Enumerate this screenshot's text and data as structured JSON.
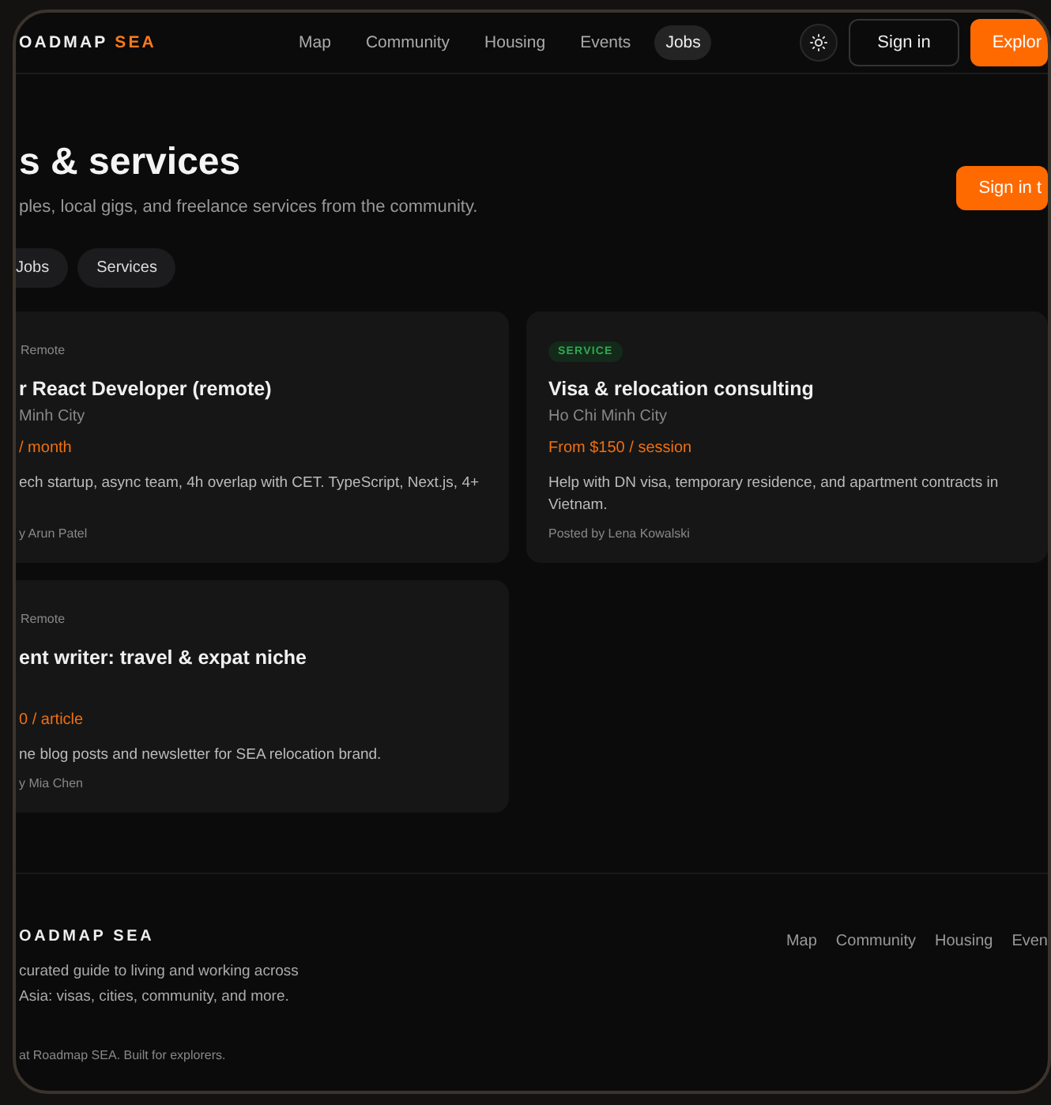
{
  "header": {
    "logo": {
      "name": "OADMAP",
      "accent": "SEA"
    },
    "nav": [
      {
        "label": "Map",
        "selected": false
      },
      {
        "label": "Community",
        "selected": false
      },
      {
        "label": "Housing",
        "selected": false
      },
      {
        "label": "Events",
        "selected": false
      },
      {
        "label": "Jobs",
        "selected": true
      }
    ],
    "sign_in": "Sign in",
    "explore": "Explor"
  },
  "page": {
    "title": "s & services",
    "subtitle": "ples, local gigs, and freelance services from the community.",
    "action": "Sign in t",
    "filters": [
      {
        "label": "Jobs",
        "selected": false
      },
      {
        "label": "Services",
        "selected": false
      }
    ]
  },
  "listings": [
    {
      "kind": "job",
      "tag": "Remote",
      "title": "r React Developer (remote)",
      "location": "Minh City",
      "price": "/ month",
      "description": "ech startup, async team, 4h overlap with CET. TypeScript, Next.js, 4+",
      "author": "y Arun Patel"
    },
    {
      "kind": "service",
      "tag": "SERVICE",
      "title": "Visa & relocation consulting",
      "location": "Ho Chi Minh City",
      "price": "From $150 / session",
      "description": "Help with DN visa, temporary residence, and apartment contracts in Vietnam.",
      "author": "Posted by Lena Kowalski"
    },
    {
      "kind": "job",
      "tag": "Remote",
      "title": "ent writer: travel & expat niche",
      "price": "0 / article",
      "description": "ne blog posts and newsletter for SEA relocation brand.",
      "author": "y Mia Chen"
    }
  ],
  "footer": {
    "logo": "OADMAP SEA",
    "description_lines": [
      "curated guide to living and working across",
      "Asia: visas, cities, community, and more."
    ],
    "copyright": "at Roadmap SEA. Built for explorers.",
    "links": [
      "Map",
      "Community",
      "Housing",
      "Even"
    ]
  }
}
